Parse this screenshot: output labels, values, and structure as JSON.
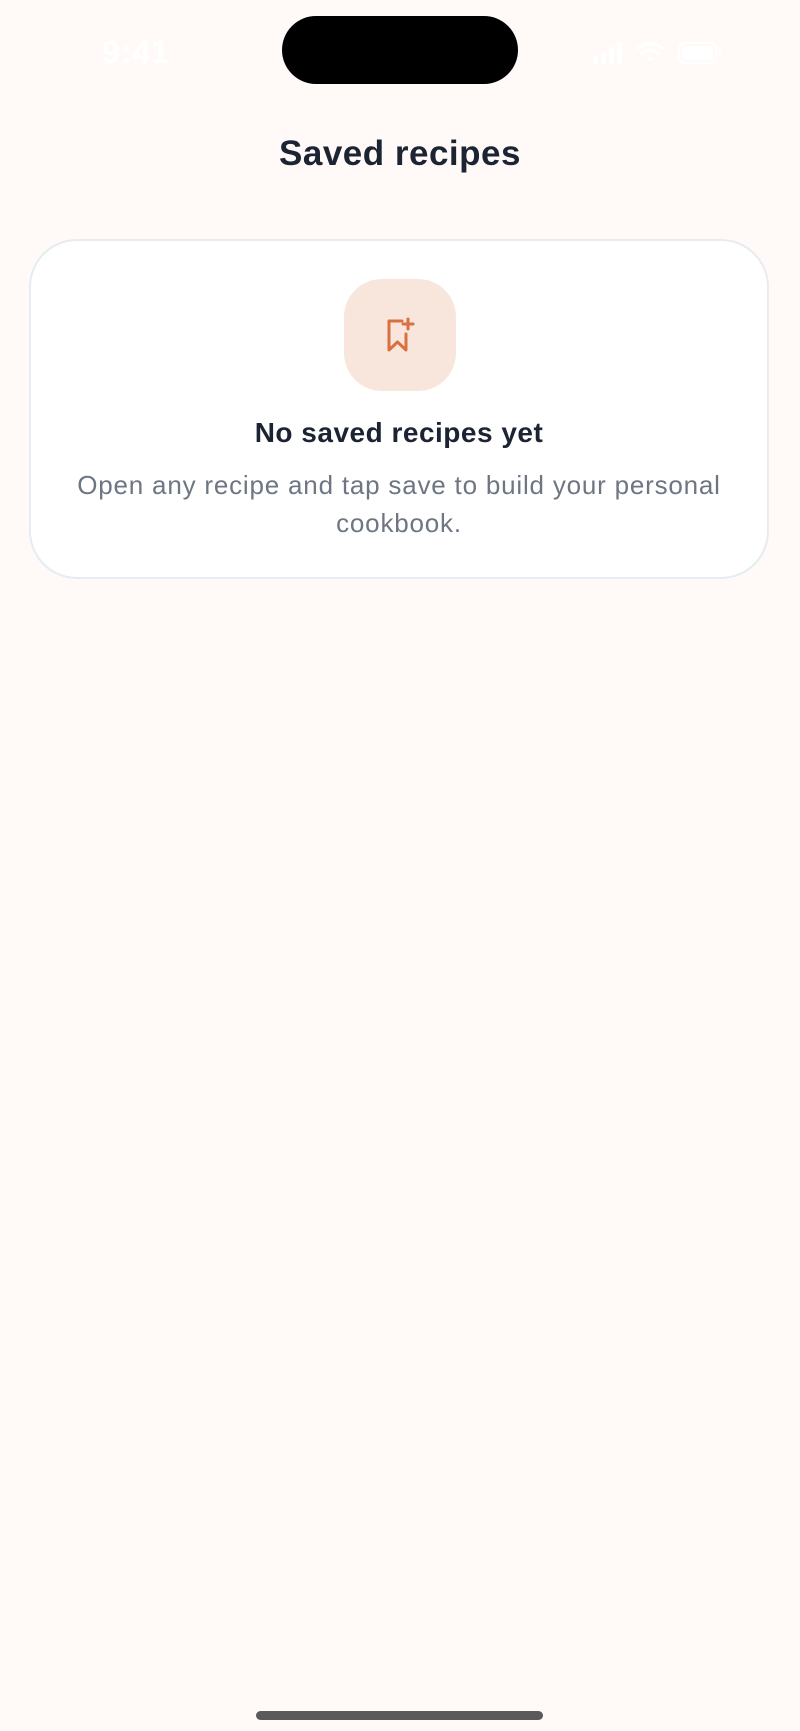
{
  "status_bar": {
    "time": "9:41"
  },
  "header": {
    "title": "Saved recipes"
  },
  "empty_state": {
    "icon": "bookmark-plus-icon",
    "title": "No saved recipes yet",
    "description": "Open any recipe and tap save to build your personal cookbook."
  },
  "colors": {
    "background": "#fffaf7",
    "accent": "#d9703f",
    "icon_tile": "#f8e6dc",
    "title_text": "#1c2333",
    "body_text": "#6e7683"
  }
}
